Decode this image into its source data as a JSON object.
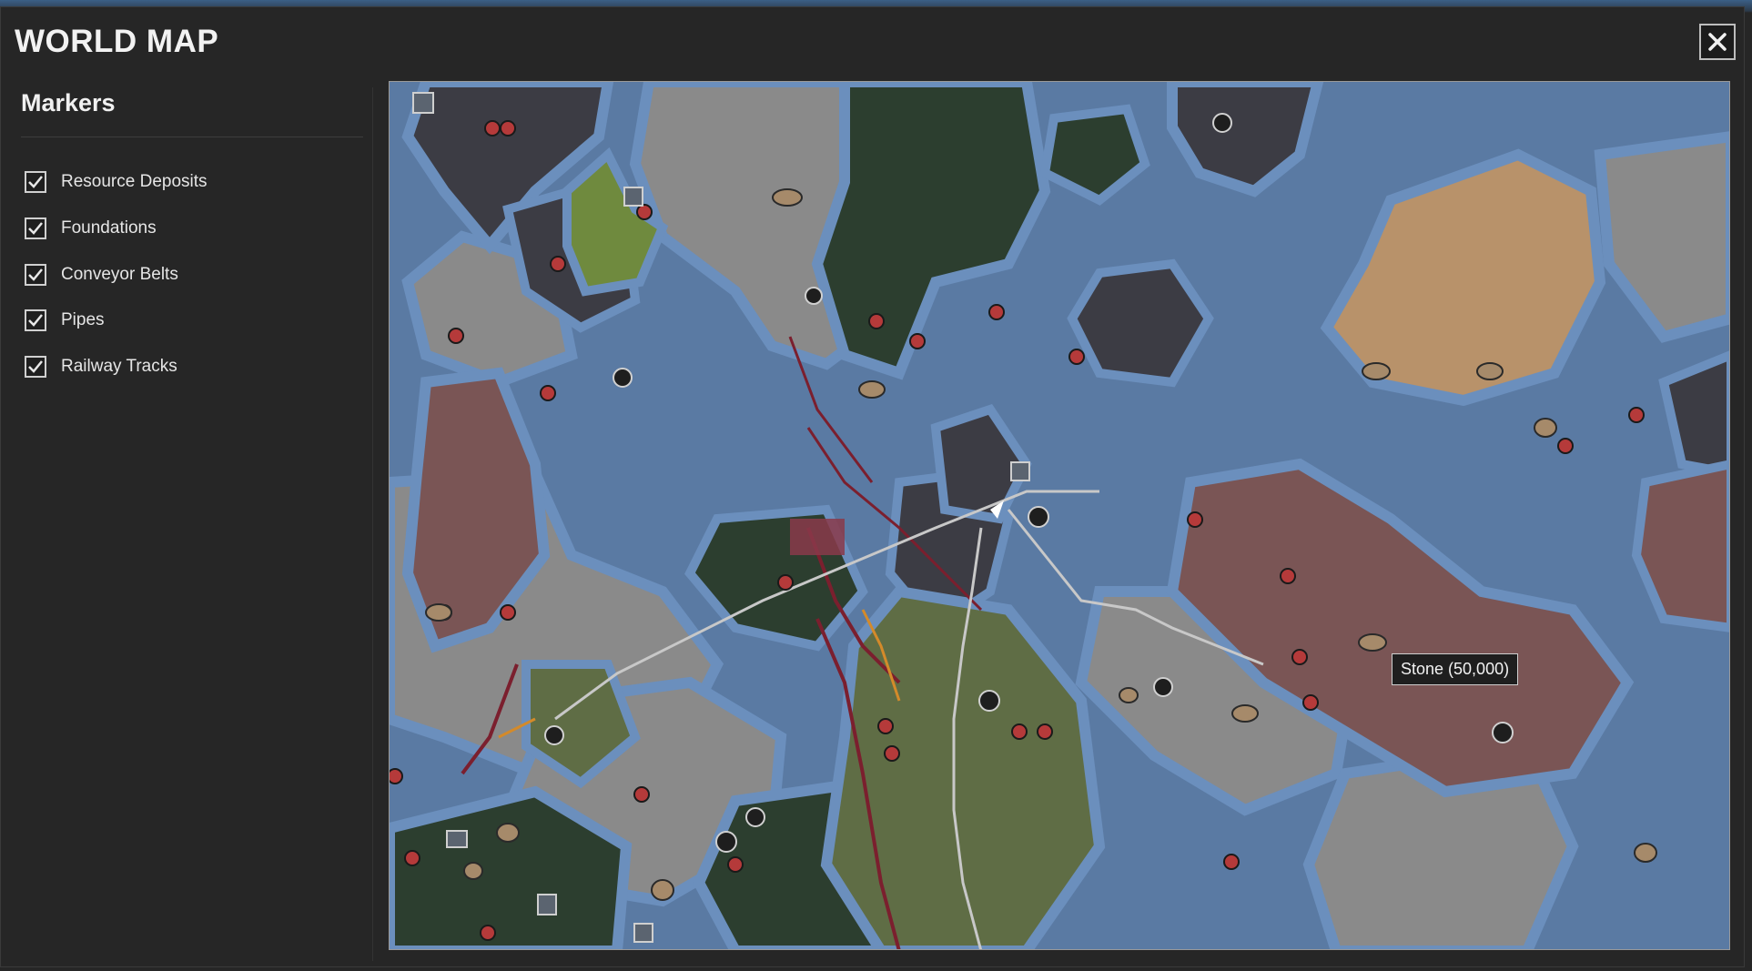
{
  "window": {
    "title": "WORLD MAP",
    "close_icon": "close-icon"
  },
  "sidebar": {
    "title": "Markers",
    "items": [
      {
        "label": "Resource Deposits",
        "checked": true
      },
      {
        "label": "Foundations",
        "checked": true
      },
      {
        "label": "Conveyor Belts",
        "checked": true
      },
      {
        "label": "Pipes",
        "checked": true
      },
      {
        "label": "Railway Tracks",
        "checked": true
      }
    ]
  },
  "map": {
    "tooltip": "Stone (50,000)",
    "colors": {
      "water": "#5a7aa3",
      "shore": "#6b8fbd",
      "gray_land": "#8a8a8a",
      "dark_land": "#3c3c44",
      "forest": "#2c3e2f",
      "olive": "#5f6d45",
      "green": "#6f8a3e",
      "red_land": "#7a5555",
      "tan_land": "#b8926a",
      "rail": "#7b1f2e",
      "conveyor": "#c8c8c8",
      "pipe": "#d48a2a"
    },
    "marker_icons": [
      "fire-crystal-icon",
      "stone-icon",
      "coal-icon",
      "iron-ore-icon"
    ]
  }
}
